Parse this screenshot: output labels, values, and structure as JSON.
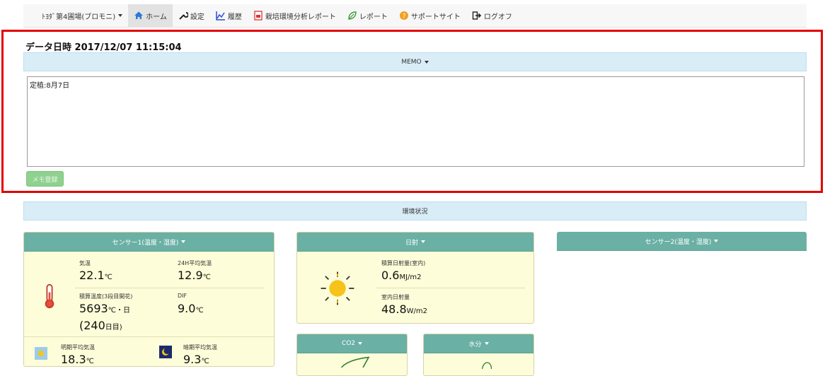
{
  "nav": {
    "site": "ﾄﾖﾀﾞ第4圃場(ブロモニ)",
    "home": "ホーム",
    "settings": "設定",
    "history": "履歴",
    "analysis_report": "栽培環境分析レポート",
    "report": "レポート",
    "support": "サポートサイト",
    "logout": "ログオフ"
  },
  "datetime": "データ日時 2017/12/07 11:15:04",
  "memo": {
    "header": "MEMO",
    "text": "定植:8月7日",
    "register_button": "メモ登録"
  },
  "env": {
    "header": "環境状況"
  },
  "sensor1": {
    "header": "センサー1(温度・湿度)",
    "temp_label": "気温",
    "temp_value": "22.1",
    "temp_unit": "℃",
    "avg24_label": "24H平均気温",
    "avg24_value": "12.9",
    "avg24_unit": "℃",
    "accum_label": "積算温度(3段目開花)",
    "accum_value": "5693",
    "accum_unit": "℃・日",
    "accum_days": "(240",
    "accum_days_unit": "日目)",
    "dif_label": "DIF",
    "dif_value": "9.0",
    "dif_unit": "℃",
    "day_avg_label": "明期平均気温",
    "day_avg_value": "18.3",
    "day_avg_unit": "℃",
    "night_avg_label": "暗期平均気温",
    "night_avg_value": "9.3",
    "night_avg_unit": "℃"
  },
  "solar": {
    "header": "日射",
    "accum_label": "積算日射量(室内)",
    "accum_value": "0.6",
    "accum_unit": "MJ/m2",
    "indoor_label": "室内日射量",
    "indoor_value": "48.8",
    "indoor_unit": "W/m2"
  },
  "sensor2": {
    "header": "センサー2(温度・湿度)"
  },
  "co2": {
    "header": "CO2"
  },
  "moisture": {
    "header": "水分"
  },
  "colors": {
    "panel_head": "#6ab0a4",
    "panel_bg": "#fdfdd9",
    "info_bg": "#d9edf7",
    "highlight": "#e00000"
  }
}
